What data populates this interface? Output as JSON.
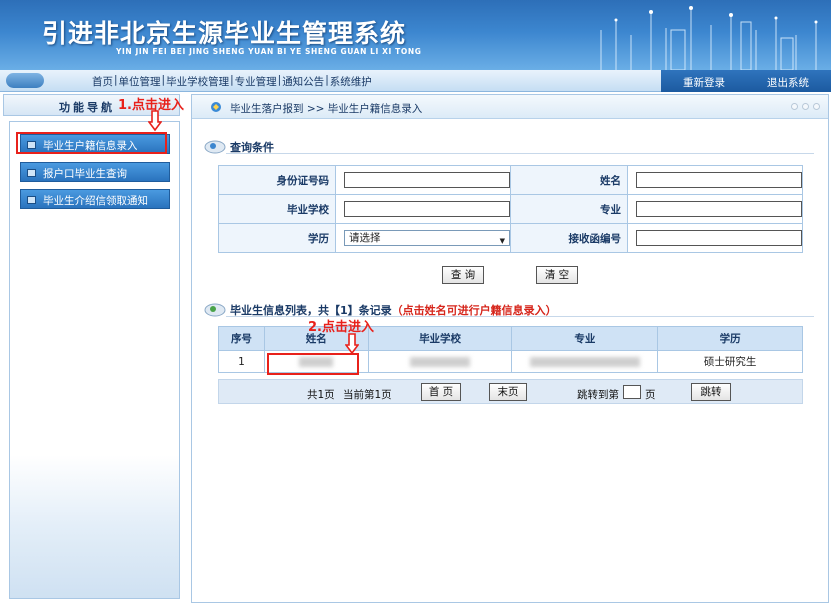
{
  "header": {
    "title": "引进非北京生源毕业生管理系统",
    "subtitle": "YIN JIN FEI BEI JING SHENG YUAN BI YE SHENG GUAN LI XI TONG"
  },
  "nav": {
    "items": [
      "首页",
      "单位管理",
      "毕业学校管理",
      "专业管理",
      "通知公告",
      "系统维护"
    ],
    "relogin": "重新登录",
    "logout": "退出系统"
  },
  "left": {
    "title": "功能导航",
    "items": [
      "毕业生户籍信息录入",
      "报户口毕业生查询",
      "毕业生介绍信领取通知"
    ]
  },
  "breadcrumb": "毕业生落户报到 >> 毕业生户籍信息录入",
  "query": {
    "section_title": "查询条件",
    "id_label": "身份证号码",
    "name_label": "姓名",
    "school_label": "毕业学校",
    "major_label": "专业",
    "degree_label": "学历",
    "degree_value": "请选择",
    "receiver_label": "接收函编号",
    "search_button": "查 询",
    "clear_button": "清 空"
  },
  "results": {
    "section_title": "毕业生信息列表，共【1】条记录",
    "section_hint": "（点击姓名可进行户籍信息录入）",
    "columns": [
      "序号",
      "姓名",
      "毕业学校",
      "专业",
      "学历"
    ],
    "rows": [
      {
        "index": "1",
        "degree": "硕士研究生"
      }
    ]
  },
  "pager": {
    "total": "共1页",
    "current": "当前第1页",
    "first": "首 页",
    "last": "末页",
    "jump_prefix": "跳转到第",
    "jump_suffix": "页",
    "jump_button": "跳转"
  },
  "annotations": {
    "step1": "1.点击进入",
    "step2": "2.点击进入"
  },
  "colors": {
    "banner": "#3c86cf",
    "annotation_red": "#e8211b",
    "menu_button": "#2a73bd"
  }
}
